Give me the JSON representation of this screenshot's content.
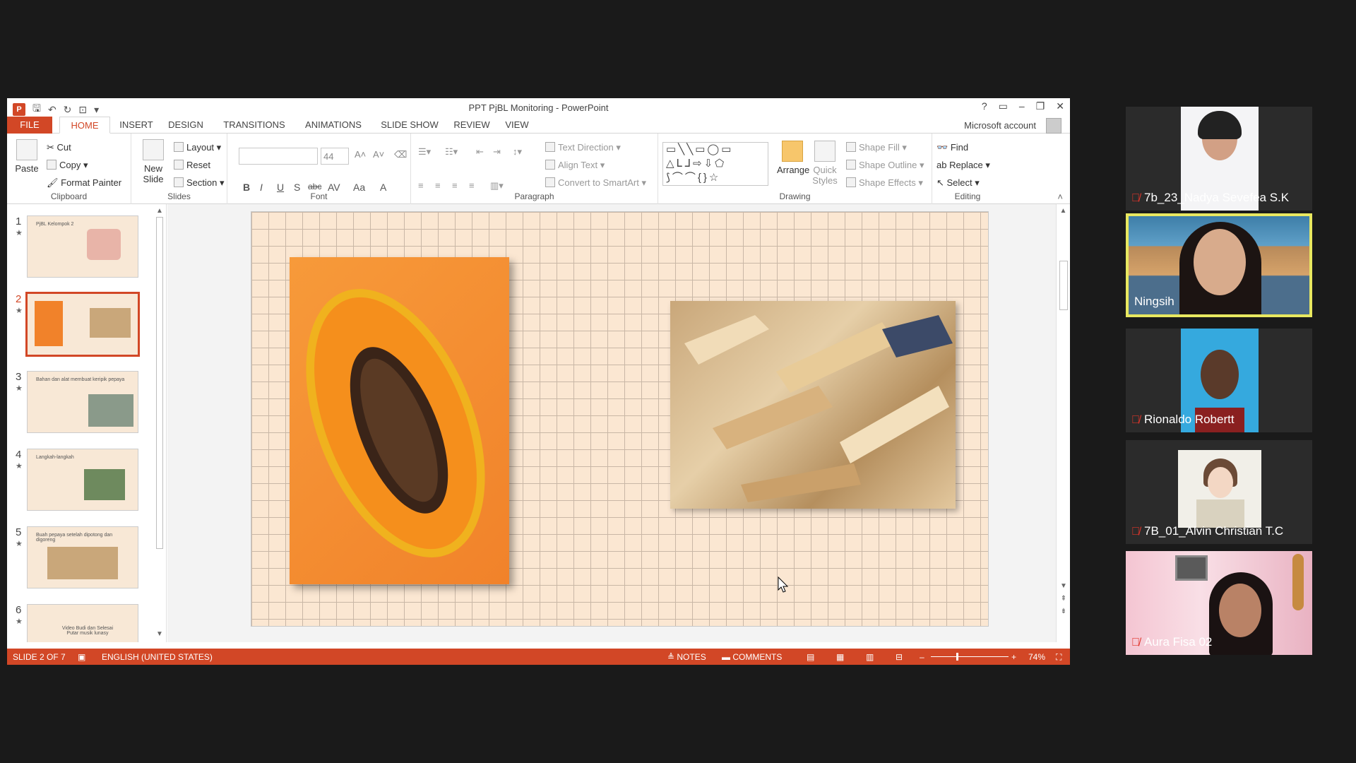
{
  "window": {
    "title": "PPT PjBL Monitoring - PowerPoint"
  },
  "tabs": [
    {
      "label": "FILE"
    },
    {
      "label": "HOME"
    },
    {
      "label": "INSERT"
    },
    {
      "label": "DESIGN"
    },
    {
      "label": "TRANSITIONS"
    },
    {
      "label": "ANIMATIONS"
    },
    {
      "label": "SLIDE SHOW"
    },
    {
      "label": "REVIEW"
    },
    {
      "label": "VIEW"
    }
  ],
  "account": "Microsoft account",
  "ribbon": {
    "clipboard": {
      "label": "Clipboard",
      "paste": "Paste",
      "cut": "Cut",
      "copy": "Copy",
      "format_painter": "Format Painter"
    },
    "slides": {
      "label": "Slides",
      "new_slide": "New Slide",
      "layout": "Layout",
      "reset": "Reset",
      "section": "Section"
    },
    "font": {
      "label": "Font",
      "size": "44",
      "bold": "B",
      "italic": "I",
      "underline": "U",
      "shadow": "S",
      "strike": "abc",
      "spacing": "AV",
      "case": "Aa",
      "color": "A"
    },
    "paragraph": {
      "label": "Paragraph",
      "text_direction": "Text Direction",
      "align_text": "Align Text",
      "convert_smartart": "Convert to SmartArt"
    },
    "drawing": {
      "label": "Drawing",
      "arrange": "Arrange",
      "quick_styles": "Quick Styles",
      "shape_fill": "Shape Fill",
      "shape_outline": "Shape Outline",
      "shape_effects": "Shape Effects"
    },
    "editing": {
      "label": "Editing",
      "find": "Find",
      "replace": "Replace",
      "select": "Select"
    }
  },
  "thumbnails": [
    {
      "num": "1",
      "title": "PjBL Kelompok 2"
    },
    {
      "num": "2",
      "title": ""
    },
    {
      "num": "3",
      "title": "Bahan dan alat membuat keripik pepaya"
    },
    {
      "num": "4",
      "title": "Langkah-langkah"
    },
    {
      "num": "5",
      "title": "Buah pepaya setelah dipotong dan digoreng"
    },
    {
      "num": "6",
      "title": "Video Budi dan Selesai Putar musik lunasy"
    }
  ],
  "statusbar": {
    "slide": "SLIDE 2 OF 7",
    "language": "ENGLISH (UNITED STATES)",
    "notes": "NOTES",
    "comments": "COMMENTS",
    "zoom": "74%"
  },
  "participants": [
    {
      "name": "7b_23_Nadya Sevefea S.K",
      "muted": true
    },
    {
      "name": "Ningsih",
      "muted": false
    },
    {
      "name": "Rionaldo Robertt",
      "muted": true
    },
    {
      "name": "7B_01_Alvin Christian T.C",
      "muted": true
    },
    {
      "name": "Aura Fisa 02",
      "muted": true
    }
  ]
}
